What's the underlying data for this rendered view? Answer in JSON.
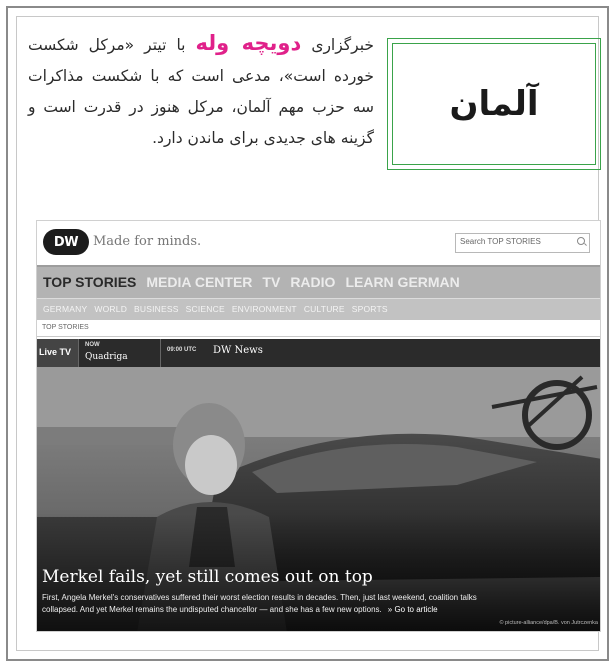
{
  "article": {
    "tag_label": "آلمان",
    "paragraph_lead": "خبرگزاری",
    "brand_name": "دویچه وله",
    "paragraph_rest": "با تیتر «مرکل شکست خورده است»، مدعی است که با شکست مذاکرات سه حزب مهم آلمان، مرکل هنوز در قدرت است و گزینه های جدیدی برای ماندن دارد."
  },
  "colors": {
    "brand": "#e0218a",
    "tag_border": "#3aa34a"
  },
  "screenshot": {
    "logo_text": "DW",
    "tagline": "Made for minds.",
    "search_placeholder": "Search TOP STORIES",
    "main_nav": [
      "TOP STORIES",
      "MEDIA CENTER",
      "TV",
      "RADIO",
      "LEARN GERMAN"
    ],
    "sub_nav": [
      "GERMANY",
      "WORLD",
      "BUSINESS",
      "SCIENCE",
      "ENVIRONMENT",
      "CULTURE",
      "SPORTS"
    ],
    "breadcrumb": "TOP STORIES",
    "live": {
      "label": "Live TV",
      "now_label": "NOW",
      "now_show": "Quadriga",
      "next_time": "09:00 UTC",
      "next_show": "DW News"
    },
    "headline": "Merkel fails, yet still comes out on top",
    "teaser": "First, Angela Merkel's conservatives suffered their worst election results in decades. Then, just last weekend, coalition talks collapsed. And yet Merkel remains the undisputed chancellor — and she has a few new options.",
    "goto_link": "» Go to article",
    "photo_credit": "© picture-alliance/dpa/B. von Jutrczenka"
  }
}
